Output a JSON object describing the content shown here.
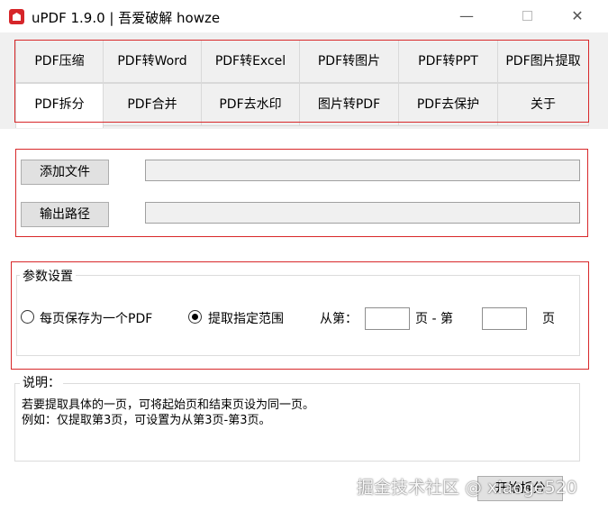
{
  "window": {
    "title": "uPDF 1.9.0 | 吾爱破解 howze",
    "minimize_glyph": "—",
    "close_glyph": "✕"
  },
  "tabs": {
    "row1": [
      "PDF压缩",
      "PDF转Word",
      "PDF转Excel",
      "PDF转图片",
      "PDF转PPT",
      "PDF图片提取"
    ],
    "row2": [
      "PDF拆分",
      "PDF合并",
      "PDF去水印",
      "图片转PDF",
      "PDF去保护",
      "关于"
    ],
    "active": "PDF拆分"
  },
  "files": {
    "add_button": "添加文件",
    "output_button": "输出路径",
    "file_path_value": "",
    "output_path_value": ""
  },
  "params": {
    "group_title": "参数设置",
    "option_each_page": "每页保存为一个PDF",
    "option_range": "提取指定范围",
    "selected_option": "提取指定范围",
    "from_label": "从第：",
    "page_dash_label": "页 - 第",
    "page_label": "页",
    "from_value": "",
    "to_value": ""
  },
  "description": {
    "title": "说明：",
    "line1": "若要提取具体的一页，可将起始页和结束页设为同一页。",
    "line2": "例如：仅提取第3页，可设置为从第3页-第3页。"
  },
  "actions": {
    "start_button": "开始拆分"
  },
  "watermark": "掘金技术社区 @ xiaoge520",
  "colors": {
    "highlight_border": "#d8282a",
    "app_icon": "#d6262a",
    "tab_bg": "#f0f0f0",
    "button_bg": "#e1e1e1"
  }
}
